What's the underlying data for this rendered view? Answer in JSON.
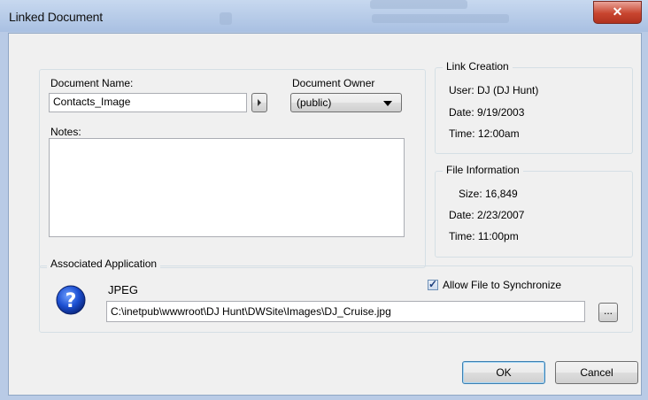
{
  "window": {
    "title": "Linked Document",
    "close_glyph": "✕"
  },
  "document": {
    "name_label": "Document Name:",
    "name_value": "Contacts_Image",
    "owner_label": "Document Owner",
    "owner_value": "(public)",
    "notes_label": "Notes:",
    "notes_value": ""
  },
  "link_creation": {
    "legend": "Link Creation",
    "user": "User: DJ (DJ Hunt)",
    "date": "Date: 9/19/2003",
    "time": "Time: 12:00am"
  },
  "file_information": {
    "legend": "File Information",
    "size": "Size: 16,849",
    "date": "Date: 2/23/2007",
    "time": "Time: 11:00pm"
  },
  "associated_application": {
    "legend": "Associated Application",
    "app_name": "JPEG",
    "sync_label": "Allow File to Synchronize",
    "sync_checked": true,
    "path_value": "C:\\inetpub\\wwwroot\\DJ Hunt\\DWSite\\Images\\DJ_Cruise.jpg",
    "browse_label": "..."
  },
  "buttons": {
    "ok": "OK",
    "cancel": "Cancel"
  },
  "icons": {
    "help": "help-question-icon",
    "checkmark": "✓",
    "dropdown": "chevron-down-icon",
    "menu": "menu-arrow-icon"
  }
}
